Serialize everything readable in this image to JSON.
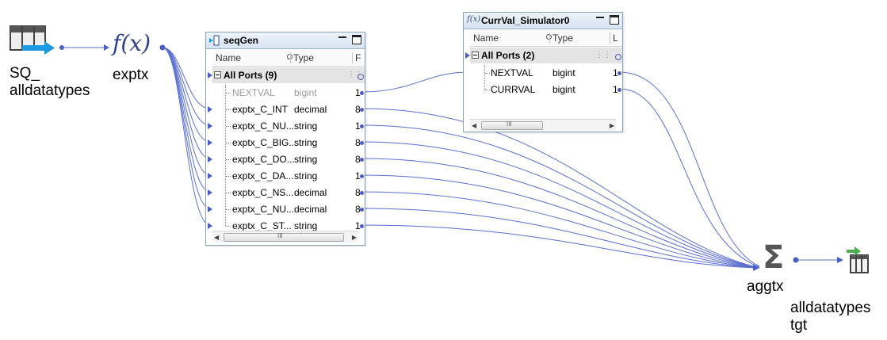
{
  "nodes": {
    "source": {
      "label": "SQ_\nalldatatypes",
      "icon": "source-qualifier-icon"
    },
    "expression": {
      "label": "exptx",
      "icon_text": "f(x)",
      "icon": "expression-function-icon"
    },
    "aggregator": {
      "label": "aggtx",
      "icon_text": "Σ",
      "icon": "aggregator-sigma-icon"
    },
    "target": {
      "label": "alldatatypes\ntgt",
      "icon": "target-table-icon"
    }
  },
  "seqGen": {
    "title": "seqGen",
    "col_name": "Name",
    "col_type": "Type",
    "col_prec": "F",
    "group": "All Ports (9)",
    "rows": [
      {
        "name": "NEXTVAL",
        "type": "bigint",
        "prec": "1"
      },
      {
        "name": "exptx_C_INT",
        "type": "decimal",
        "prec": "8"
      },
      {
        "name": "exptx_C_NU...",
        "type": "string",
        "prec": "1"
      },
      {
        "name": "exptx_C_BIG...",
        "type": "string",
        "prec": "8"
      },
      {
        "name": "exptx_C_DO...",
        "type": "string",
        "prec": "8"
      },
      {
        "name": "exptx_C_DA...",
        "type": "string",
        "prec": "1"
      },
      {
        "name": "exptx_C_NS...",
        "type": "decimal",
        "prec": "8"
      },
      {
        "name": "exptx_C_NU...",
        "type": "decimal",
        "prec": "8"
      },
      {
        "name": "exptx_C_ST...",
        "type": "string",
        "prec": "1"
      }
    ],
    "scroll_mark": "III"
  },
  "currVal": {
    "title": "CurrVal_Simulator0",
    "title_icon": "f(x)",
    "col_name": "Name",
    "col_type": "Type",
    "col_prec": "L",
    "group": "All Ports (2)",
    "rows": [
      {
        "name": "NEXTVAL",
        "type": "bigint",
        "prec": "1"
      },
      {
        "name": "CURRVAL",
        "type": "bigint",
        "prec": "1"
      }
    ],
    "scroll_mark": "III"
  },
  "colors": {
    "link": "#5a6fd0",
    "panel_border": "#8aa3bd",
    "title_bg": "#d6e3f1",
    "group_bg": "#e4e4e4"
  }
}
